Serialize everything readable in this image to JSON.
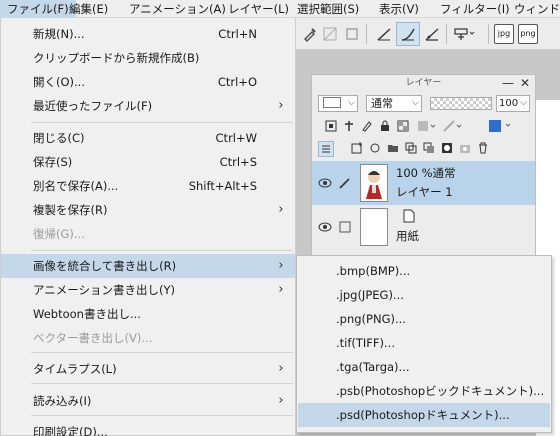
{
  "menubar": {
    "items": [
      "ファイル(F)",
      "編集(E)",
      "アニメーション(A)",
      "レイヤー(L)",
      "選択範囲(S)",
      "表示(V)",
      "フィルター(I)",
      "ウィンドウ("
    ]
  },
  "toolbar": {
    "icons": [
      "eyedropper-icon",
      "grid-icon",
      "square-icon",
      "line-tool-icon",
      "curve-tool-icon",
      "ruler-icon",
      "transform-icon",
      "export-jpg-icon",
      "export-png-icon"
    ],
    "jpg_label": "jpg",
    "png_label": "png"
  },
  "layer_panel": {
    "title": "レイヤー",
    "blend_mode": "通常",
    "opacity": "100",
    "layers": [
      {
        "line1": "100 %通常",
        "line2": "レイヤー 1",
        "selected": true
      },
      {
        "line1": "用紙",
        "selected": false
      }
    ]
  },
  "file_menu": {
    "items": [
      {
        "label": "新規(N)...",
        "shortcut": "Ctrl+N",
        "submenu": false,
        "disabled": false
      },
      {
        "label": "クリップボードから新規作成(B)",
        "shortcut": "",
        "submenu": false,
        "disabled": false
      },
      {
        "label": "開く(O)...",
        "shortcut": "Ctrl+O",
        "submenu": false,
        "disabled": false
      },
      {
        "label": "最近使ったファイル(F)",
        "shortcut": "",
        "submenu": true,
        "disabled": false
      },
      {
        "label": "閉じる(C)",
        "shortcut": "Ctrl+W",
        "submenu": false,
        "disabled": false
      },
      {
        "label": "保存(S)",
        "shortcut": "Ctrl+S",
        "submenu": false,
        "disabled": false
      },
      {
        "label": "別名で保存(A)...",
        "shortcut": "Shift+Alt+S",
        "submenu": false,
        "disabled": false
      },
      {
        "label": "複製を保存(R)",
        "shortcut": "",
        "submenu": true,
        "disabled": false
      },
      {
        "label": "復帰(G)...",
        "shortcut": "",
        "submenu": false,
        "disabled": true
      },
      {
        "label": "画像を統合して書き出し(R)",
        "shortcut": "",
        "submenu": true,
        "disabled": false
      },
      {
        "label": "アニメーション書き出し(Y)",
        "shortcut": "",
        "submenu": true,
        "disabled": false
      },
      {
        "label": "Webtoon書き出し...",
        "shortcut": "",
        "submenu": false,
        "disabled": false
      },
      {
        "label": "ベクター書き出し(V)...",
        "shortcut": "",
        "submenu": false,
        "disabled": true
      },
      {
        "label": "タイムラプス(L)",
        "shortcut": "",
        "submenu": true,
        "disabled": false
      },
      {
        "label": "読み込み(I)",
        "shortcut": "",
        "submenu": true,
        "disabled": false
      },
      {
        "label": "印刷設定(D)...",
        "shortcut": "",
        "submenu": false,
        "disabled": false
      }
    ]
  },
  "export_submenu": {
    "items": [
      ".bmp(BMP)...",
      ".jpg(JPEG)...",
      ".png(PNG)...",
      ".tif(TIFF)...",
      ".tga(Targa)...",
      ".psb(Photoshopビックドキュメント)...",
      ".psd(Photoshopドキュメント)..."
    ]
  },
  "colors": {
    "highlight": "#c4d8ea",
    "menu_bg": "#f0f0f0",
    "layer_selected": "#b9d3ea"
  }
}
